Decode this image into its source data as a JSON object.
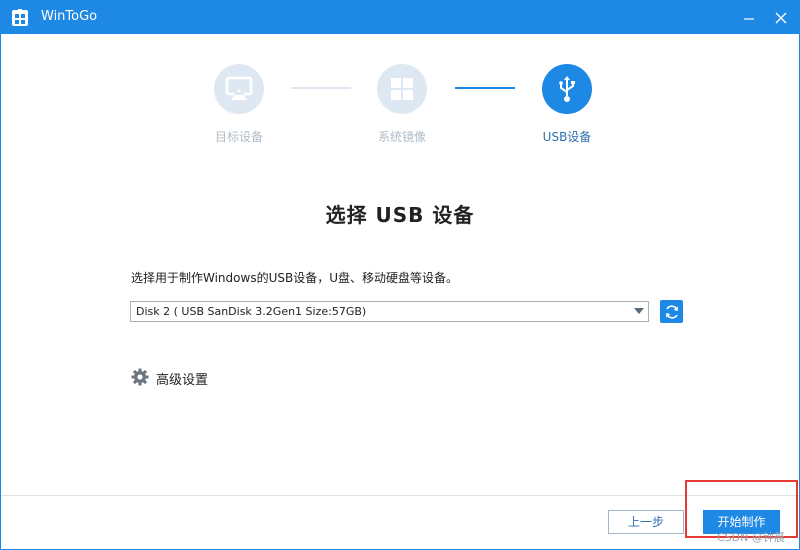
{
  "window": {
    "title": "WinToGo"
  },
  "steps": [
    {
      "label": "目标设备",
      "icon": "airplay-icon",
      "state": "done"
    },
    {
      "label": "系统镜像",
      "icon": "windows-logo-icon",
      "state": "done"
    },
    {
      "label": "USB设备",
      "icon": "usb-icon",
      "state": "active"
    }
  ],
  "main": {
    "heading": "选择 USB 设备",
    "description": "选择用于制作Windows的USB设备，U盘、移动硬盘等设备。",
    "device_select": {
      "value": "Disk 2 ( USB SanDisk 3.2Gen1 Size:57GB)"
    },
    "advanced_label": "高级设置"
  },
  "footer": {
    "prev_label": "上一步",
    "start_label": "开始制作"
  },
  "watermark": "CSDN @钟晨",
  "colors": {
    "accent": "#1e88e5",
    "highlight_border": "#e53935",
    "done_step": "#dde8f2"
  }
}
